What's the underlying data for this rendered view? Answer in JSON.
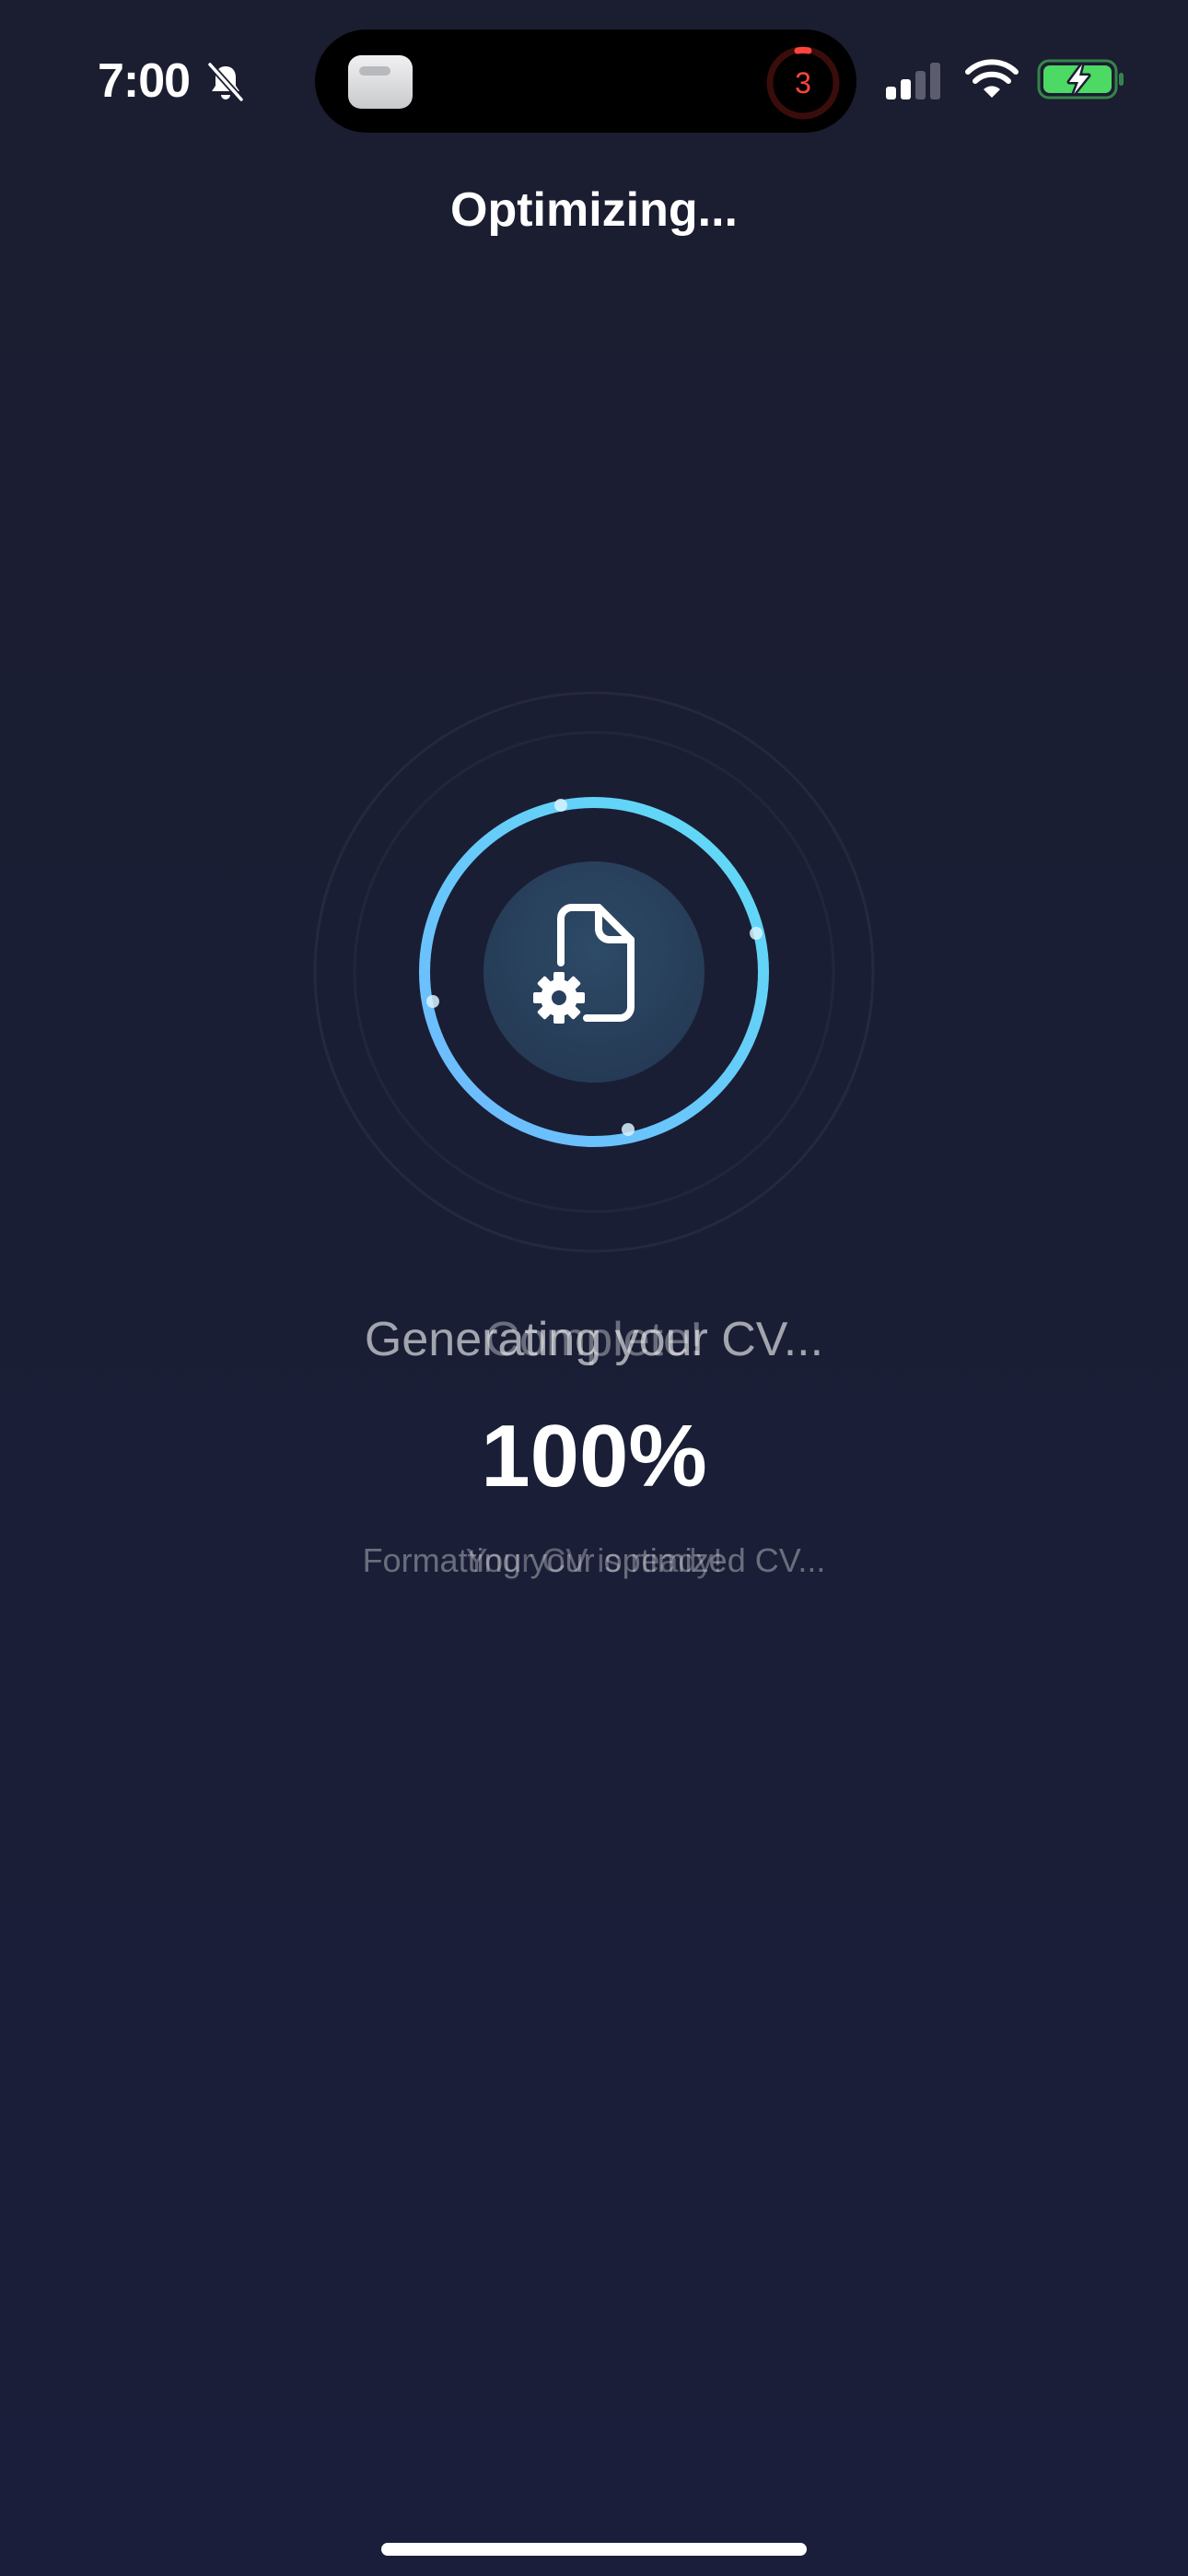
{
  "status_bar": {
    "time": "7:00",
    "timer_count": "3",
    "icons": [
      "bell-slash-icon",
      "app-icon",
      "timer-icon",
      "signal-icon",
      "wifi-icon",
      "battery-charging-icon"
    ]
  },
  "header": {
    "title": "Optimizing..."
  },
  "loader": {
    "icon": "document-gear-icon",
    "progress": 1.0,
    "ring_colors": [
      "#6fb8ff",
      "#5fdcf5"
    ]
  },
  "status": {
    "heading_primary": "Generating your CV...",
    "heading_transition": "Complete!",
    "percent": "100%",
    "sub_primary": "Formatting your optimized CV...",
    "sub_transition": "Your CV is ready!"
  },
  "colors": {
    "background": "#1b1d32",
    "accent": "#5fc8f5",
    "battery": "#4cd964",
    "timer": "#ff453a"
  }
}
